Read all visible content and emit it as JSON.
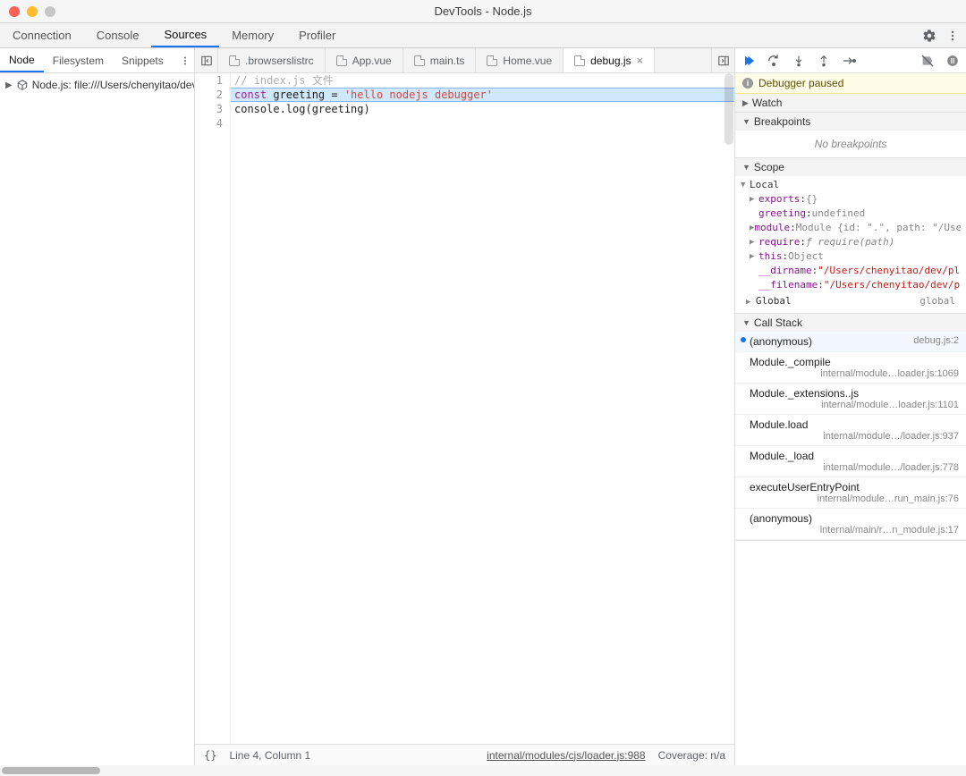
{
  "window": {
    "title": "DevTools - Node.js"
  },
  "mainTabs": [
    "Connection",
    "Console",
    "Sources",
    "Memory",
    "Profiler"
  ],
  "mainTabActive": 2,
  "leftSubTabs": [
    "Node",
    "Filesystem",
    "Snippets"
  ],
  "leftSubTabActive": 0,
  "navTree": {
    "root": "Node.js: file:///Users/chenyitao/dev"
  },
  "fileTabs": [
    {
      "name": ".browserslistrc",
      "active": false
    },
    {
      "name": "App.vue",
      "active": false
    },
    {
      "name": "main.ts",
      "active": false
    },
    {
      "name": "Home.vue",
      "active": false
    },
    {
      "name": "debug.js",
      "active": true
    }
  ],
  "editor": {
    "lines": [
      {
        "n": 1,
        "type": "comment",
        "text": "// index.js 文件"
      },
      {
        "n": 2,
        "type": "const",
        "kw": "const",
        "ident": " greeting ",
        "op": "= ",
        "str": "'hello nodejs debugger'"
      },
      {
        "n": 3,
        "type": "plain",
        "text": "console.log(greeting)"
      },
      {
        "n": 4,
        "type": "plain",
        "text": ""
      }
    ],
    "highlightedLine": 2
  },
  "statusBar": {
    "cursor": "Line 4, Column 1",
    "source": "internal/modules/cjs/loader.js:988",
    "coverage": "Coverage: n/a"
  },
  "debugger": {
    "pausedLabel": "Debugger paused",
    "sections": {
      "watch": "Watch",
      "breakpoints": "Breakpoints",
      "breakpointsEmpty": "No breakpoints",
      "scope": "Scope",
      "callstack": "Call Stack"
    },
    "scope": {
      "localLabel": "Local",
      "vars": [
        {
          "name": "exports",
          "value": "{}",
          "expandable": true
        },
        {
          "name": "greeting",
          "value": "undefined",
          "expandable": false
        },
        {
          "name": "module",
          "value": "Module {id: \".\", path: \"/Use…",
          "expandable": true
        },
        {
          "name": "require",
          "value": "ƒ require(path)",
          "expandable": true,
          "italic": true
        },
        {
          "name": "this",
          "value": "Object",
          "expandable": true
        },
        {
          "name": "__dirname",
          "value": "\"/Users/chenyitao/dev/pla…",
          "expandable": false,
          "string": true,
          "indent": true
        },
        {
          "name": "__filename",
          "value": "\"/Users/chenyitao/dev/pl…",
          "expandable": false,
          "string": true,
          "indent": true
        }
      ],
      "globalLabel": "Global",
      "globalValue": "global"
    },
    "callstack": [
      {
        "fn": "(anonymous)",
        "loc": "debug.js:2",
        "current": true
      },
      {
        "fn": "Module._compile",
        "loc": "internal/module…loader.js:1069"
      },
      {
        "fn": "Module._extensions..js",
        "loc": "internal/module…loader.js:1101"
      },
      {
        "fn": "Module.load",
        "loc": "internal/module…/loader.js:937"
      },
      {
        "fn": "Module._load",
        "loc": "internal/module…/loader.js:778"
      },
      {
        "fn": "executeUserEntryPoint",
        "loc": "internal/module…run_main.js:76"
      },
      {
        "fn": "(anonymous)",
        "loc": "internal/main/r…n_module.js:17"
      }
    ]
  }
}
